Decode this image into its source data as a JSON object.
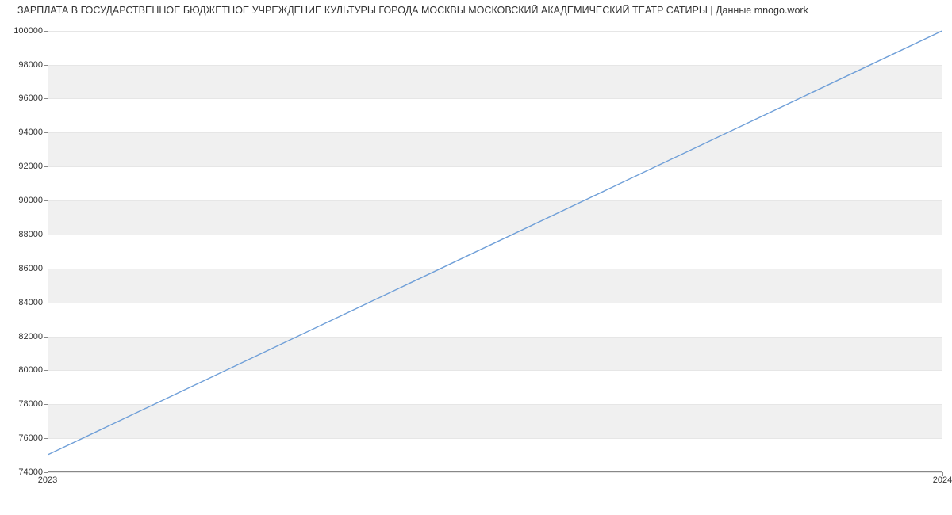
{
  "chart_data": {
    "type": "line",
    "title": "ЗАРПЛАТА В ГОСУДАРСТВЕННОЕ БЮДЖЕТНОЕ УЧРЕЖДЕНИЕ КУЛЬТУРЫ ГОРОДА МОСКВЫ МОСКОВСКИЙ АКАДЕМИЧЕСКИЙ ТЕАТР САТИРЫ | Данные mnogo.work",
    "x": [
      "2023",
      "2024"
    ],
    "values": [
      75000,
      100000
    ],
    "xlabel": "",
    "ylabel": "",
    "ylim": [
      74000,
      100500
    ],
    "y_ticks": [
      74000,
      76000,
      78000,
      80000,
      82000,
      84000,
      86000,
      88000,
      90000,
      92000,
      94000,
      96000,
      98000,
      100000
    ],
    "line_color": "#6f9fd8"
  }
}
